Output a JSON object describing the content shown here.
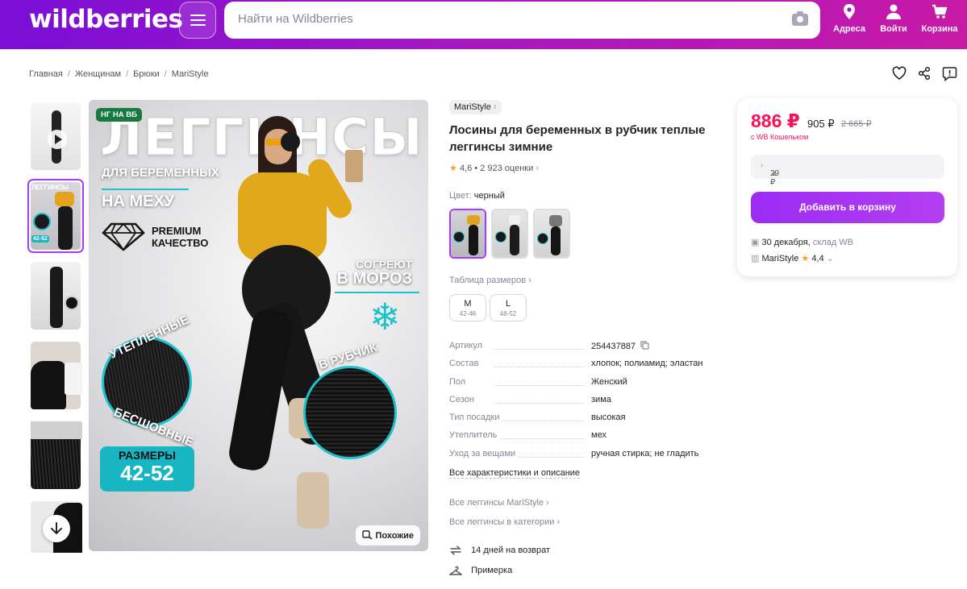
{
  "header": {
    "logo": "wildberries",
    "search_placeholder": "Найти на Wildberries",
    "actions": [
      {
        "label": "Адреса",
        "icon": "location-pin-icon"
      },
      {
        "label": "Войти",
        "icon": "user-icon"
      },
      {
        "label": "Корзина",
        "icon": "cart-icon"
      }
    ]
  },
  "breadcrumbs": [
    "Главная",
    "Женщинам",
    "Брюки",
    "MariStyle"
  ],
  "gallery": {
    "badge": "НГ НА ВБ",
    "title": "ЛЕГГИНСЫ",
    "subtitle1": "ДЛЯ БЕРЕМЕННЫХ",
    "subtitle2": "НА МЕХУ",
    "premium1": "PREMIUM",
    "premium2": "КАЧЕСТВО",
    "warm1": "СОГРЕЮТ",
    "warm2": "В МОРОЗ",
    "circle1_top": "УТЕПЛЁННЫЕ",
    "circle1_bottom": "БЕСШОВНЫЕ",
    "circle2_top": "В РУБЧИК",
    "sizes_label": "РАЗМЕРЫ",
    "sizes_value": "42-52",
    "similar_button": "Похожие",
    "thumb1_text": "ЛЕГГИНСЫ",
    "thumb1_size": "42-52"
  },
  "product": {
    "brand": "MariStyle",
    "title": "Лосины для беременных в рубчик теплые леггинсы зимние",
    "rating": "4,6",
    "reviews": "2 923 оценки",
    "color_label": "Цвет:",
    "color_value": "черный",
    "size_table_link": "Таблица размеров",
    "sizes": [
      {
        "size": "M",
        "range": "42-46"
      },
      {
        "size": "L",
        "range": "48-52"
      }
    ],
    "specs": [
      {
        "key": "Артикул",
        "value": "254437887"
      },
      {
        "key": "Состав",
        "value": "хлопок; полиамид; эластан"
      },
      {
        "key": "Пол",
        "value": "Женский"
      },
      {
        "key": "Сезон",
        "value": "зима"
      },
      {
        "key": "Тип посадки",
        "value": "высокая"
      },
      {
        "key": "Утеплитель",
        "value": "мех"
      },
      {
        "key": "Уход за вещами",
        "value": "ручная стирка; не гладить"
      }
    ],
    "all_specs_link": "Все характеристики и описание",
    "brand_link": "Все леггинсы MariStyle",
    "category_link": "Все леггинсы в категории",
    "features": [
      "14 дней на возврат",
      "Примерка"
    ]
  },
  "price_card": {
    "price": "886 ₽",
    "price_regular": "905 ₽",
    "price_old": "2 665 ₽",
    "wallet_note": "с WB Кошельком",
    "installment": "29 ₽",
    "add_to_cart": "Добавить в корзину",
    "delivery_date": "30 декабря,",
    "delivery_where": "склад WB",
    "seller": "MariStyle",
    "seller_rating": "4,4"
  },
  "colors": {
    "accent": "#a73afd",
    "price": "#f91155",
    "header_start": "#7a0ed6",
    "header_end": "#c81aa6",
    "star": "#ff9b26"
  }
}
